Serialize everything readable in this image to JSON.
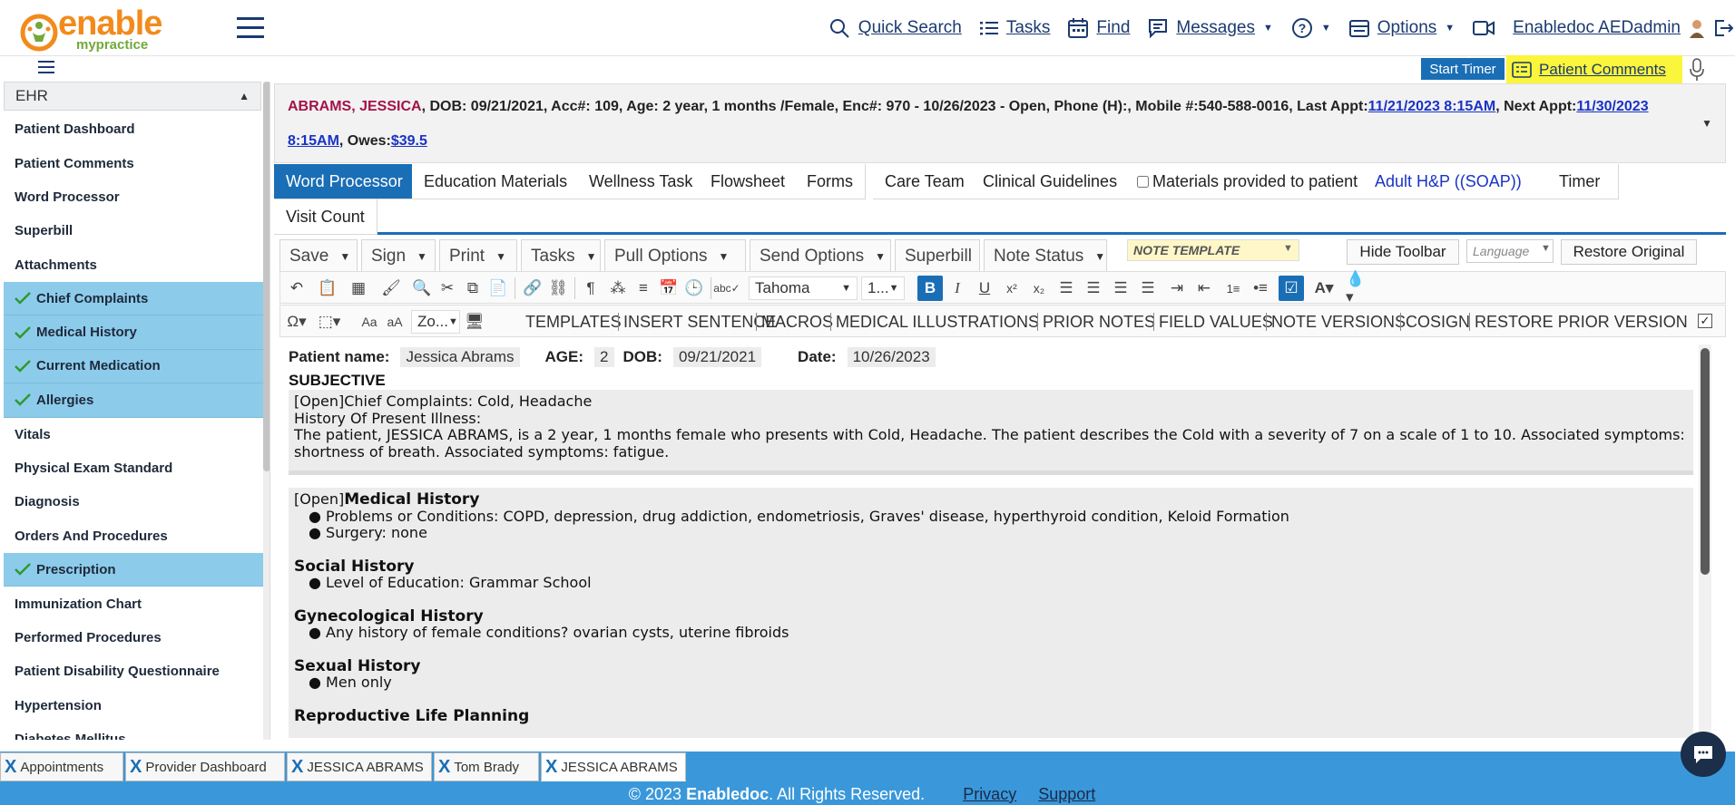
{
  "brand": {
    "logo_main": "enable",
    "logo_sub": "mypractice",
    "orange": "#f28b1c",
    "green": "#72a93b"
  },
  "topnav": {
    "quick_search": "Quick Search",
    "tasks": "Tasks",
    "find": "Find",
    "messages": "Messages",
    "options": "Options",
    "user": "Enabledoc AEDadmin"
  },
  "toolbar_top": {
    "start_timer": "Start Timer",
    "patient_comments": "Patient Comments"
  },
  "sidebar": {
    "header": "EHR",
    "items": [
      {
        "label": "Patient Dashboard",
        "done": false
      },
      {
        "label": "Patient Comments",
        "done": false
      },
      {
        "label": "Word Processor",
        "done": false
      },
      {
        "label": "Superbill",
        "done": false
      },
      {
        "label": "Attachments",
        "done": false
      },
      {
        "label": "Chief Complaints",
        "done": true
      },
      {
        "label": "Medical History",
        "done": true
      },
      {
        "label": "Current Medication",
        "done": true
      },
      {
        "label": "Allergies",
        "done": true
      },
      {
        "label": "Vitals",
        "done": false
      },
      {
        "label": "Physical Exam Standard",
        "done": false
      },
      {
        "label": "Diagnosis",
        "done": false
      },
      {
        "label": "Orders And Procedures",
        "done": false
      },
      {
        "label": "Prescription",
        "done": true
      },
      {
        "label": "Immunization Chart",
        "done": false
      },
      {
        "label": "Performed Procedures",
        "done": false
      },
      {
        "label": "Patient Disability Questionnaire",
        "done": false
      },
      {
        "label": "Hypertension",
        "done": false
      },
      {
        "label": "Diabetes Mellitus",
        "done": false
      }
    ]
  },
  "patient": {
    "name": "ABRAMS, JESSICA",
    "details": ", DOB: 09/21/2021, Acc#: 109, Age: 2 year, 1 months /Female, Enc#: 970 - 10/26/2023 - Open, Phone (H):, Mobile #:540-588-0016, Last Appt:",
    "last_appt": "11/21/2023 8:15AM",
    "next_label": ", Next Appt:",
    "next_appt": "11/30/2023 8:15AM",
    "owes_label": ", Owes:",
    "owes": "$39.5"
  },
  "tabs": [
    "Word Processor",
    "Education Materials",
    "Wellness Task",
    "Flowsheet",
    "Forms",
    "Care Team",
    "Clinical Guidelines",
    "Materials provided to patient",
    "Adult H&P ((SOAP))",
    "Timer",
    "Visit Count"
  ],
  "editor_toolbar": {
    "save": "Save",
    "sign": "Sign",
    "print": "Print",
    "tasks": "Tasks",
    "pull_options": "Pull Options",
    "send_options": "Send Options",
    "superbill": "Superbill",
    "note_status": "Note Status",
    "note_template": "NOTE TEMPLATE",
    "hide_toolbar": "Hide Toolbar",
    "language": "Language",
    "restore_original": "Restore Original",
    "font": "Tahoma",
    "font_size": "1...",
    "zoom": "Zo...",
    "links": [
      "TEMPLATES",
      "INSERT SENTENCE",
      "MACROS",
      "MEDICAL ILLUSTRATIONS",
      "PRIOR NOTES",
      "FIELD VALUES",
      "NOTE VERSIONS",
      "COSIGN",
      "RESTORE PRIOR VERSION"
    ]
  },
  "note": {
    "patient_name_label": "Patient name:",
    "patient_name": "Jessica Abrams",
    "age_label": "AGE:",
    "age": "2",
    "dob_label": "DOB:",
    "dob": "09/21/2021",
    "date_label": "Date:",
    "date": "10/26/2023",
    "subjective": "SUBJECTIVE",
    "cc_prefix": "[Open]",
    "cc_line": "Chief Complaints: Cold, Headache",
    "hpi_title": "History Of Present Illness:",
    "hpi_text": "The patient, JESSICA ABRAMS, is a 2 year, 1 months female who presents with Cold, Headache.  The patient describes the Cold with a severity of 7 on a scale of 1 to 10. Associated symptoms: shortness of breath.   Associated symptoms: fatigue.",
    "mh_prefix": "[Open]",
    "mh_title": "Medical History",
    "mh_items": [
      "Problems or Conditions: COPD, depression, drug addiction, endometriosis, Graves' disease, hyperthyroid condition, Keloid Formation",
      "Surgery: none"
    ],
    "social_title": "Social History",
    "social_items": [
      "Level of Education: Grammar School"
    ],
    "gyn_title": "Gynecological History",
    "gyn_items": [
      "Any history of female conditions? ovarian cysts, uterine fibroids"
    ],
    "sex_title": "Sexual History",
    "sex_items": [
      "Men only"
    ],
    "repro_title": "Reproductive Life Planning"
  },
  "bottom_tabs": [
    "Appointments",
    "Provider Dashboard",
    "JESSICA ABRAMS",
    "Tom Brady",
    "JESSICA ABRAMS"
  ],
  "footer": {
    "copyright_prefix": "© 2023",
    "company": "Enabledoc",
    "copyright_suffix": ". All Rights Reserved.",
    "privacy": "Privacy",
    "support": "Support"
  }
}
